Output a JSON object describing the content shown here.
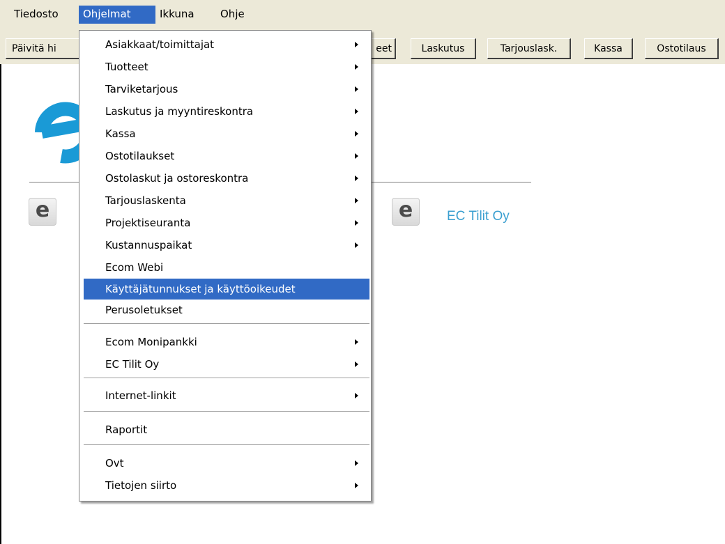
{
  "menubar": {
    "items": [
      "Tiedosto",
      "Ohjelmat",
      "Ikkuna",
      "Ohje"
    ],
    "active": "Ohjelmat"
  },
  "toolbar": {
    "buttons": [
      "Päivitä hi",
      "eet",
      "Laskutus",
      "Tarjouslask.",
      "Kassa",
      "Ostotilaus"
    ]
  },
  "main": {
    "logo_glyph": "e",
    "company_name": "EC Tilit Oy"
  },
  "menu": {
    "items": [
      {
        "label": "Asiakkaat/toimittajat",
        "submenu": true
      },
      {
        "label": "Tuotteet",
        "submenu": true
      },
      {
        "label": "Tarviketarjous",
        "submenu": true
      },
      {
        "label": "Laskutus ja myyntireskontra",
        "submenu": true
      },
      {
        "label": "Kassa",
        "submenu": true
      },
      {
        "label": "Ostotilaukset",
        "submenu": true
      },
      {
        "label": "Ostolaskut ja ostoreskontra",
        "submenu": true
      },
      {
        "label": "Tarjouslaskenta",
        "submenu": true
      },
      {
        "label": "Projektiseuranta",
        "submenu": true
      },
      {
        "label": "Kustannuspaikat",
        "submenu": true
      },
      {
        "label": "Ecom Webi",
        "submenu": false
      },
      {
        "label": "Käyttäjätunnukset ja käyttöoikeudet",
        "submenu": false,
        "selected": true
      },
      {
        "label": "Perusoletukset",
        "submenu": false
      },
      {
        "label": "Ecom Monipankki",
        "submenu": true
      },
      {
        "label": "EC Tilit Oy",
        "submenu": true
      },
      {
        "label": "Internet-linkit",
        "submenu": true
      },
      {
        "label": "Raportit",
        "submenu": false
      },
      {
        "label": "Ovt",
        "submenu": true
      },
      {
        "label": "Tietojen siirto",
        "submenu": true
      }
    ]
  },
  "colors": {
    "selection": "#316ac5",
    "logo_blue": "#1a9ad6",
    "chrome": "#ece9d8"
  }
}
